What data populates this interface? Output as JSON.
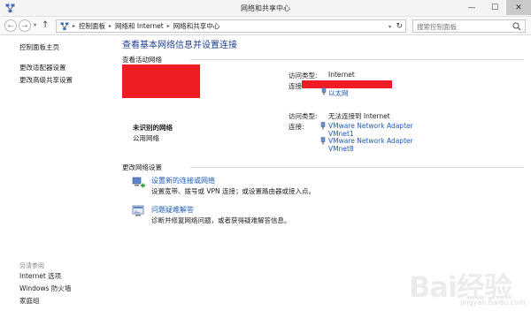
{
  "window": {
    "title": "网络和共享中心",
    "min_glyph": "—",
    "max_glyph": "☐",
    "close_glyph": "✕"
  },
  "address": {
    "crumbs": [
      "控制面板",
      "网络和 Internet",
      "网络和共享中心"
    ],
    "search_placeholder": "搜索控制面板"
  },
  "sidebar": {
    "items": [
      {
        "label": "控制面板主页"
      },
      {
        "label": "更改适配器设置"
      },
      {
        "label": "更改高级共享设置"
      }
    ],
    "see_also_title": "另请参阅",
    "see_also": [
      {
        "label": "Internet 选项"
      },
      {
        "label": "Windows 防火墙"
      },
      {
        "label": "家庭组"
      }
    ]
  },
  "main": {
    "title": "查看基本网络信息并设置连接",
    "active_networks_label": "查看活动网络",
    "network1": {
      "access_type_label": "访问类型:",
      "access_type_value": "Internet",
      "connections_label": "连接:",
      "adapter_link": "以太网"
    },
    "network2": {
      "name": "未识别的网络",
      "type": "公用网络",
      "access_type_label": "访问类型:",
      "access_type_value": "无法连接到 Internet",
      "connections_label": "连接:",
      "adapters": [
        {
          "line1": "VMware Network Adapter",
          "line2": "VMnet1"
        },
        {
          "line1": "VMware Network Adapter",
          "line2": "VMnet8"
        }
      ]
    },
    "change_settings_label": "更改网络设置",
    "tasks": [
      {
        "link": "设置新的连接或网络",
        "desc": "设置宽带、拨号或 VPN 连接；或设置路由器或接入点。"
      },
      {
        "link": "问题疑难解答",
        "desc": "诊断并修复网络问题，或者获得疑难解答信息。"
      }
    ]
  },
  "colors": {
    "link": "#1e5ab4",
    "title": "#1e3e8c",
    "redaction": "#ee1c25"
  },
  "watermark": {
    "logo_text": "Bai经验",
    "sub_text": "jingyan.baidu.com"
  }
}
